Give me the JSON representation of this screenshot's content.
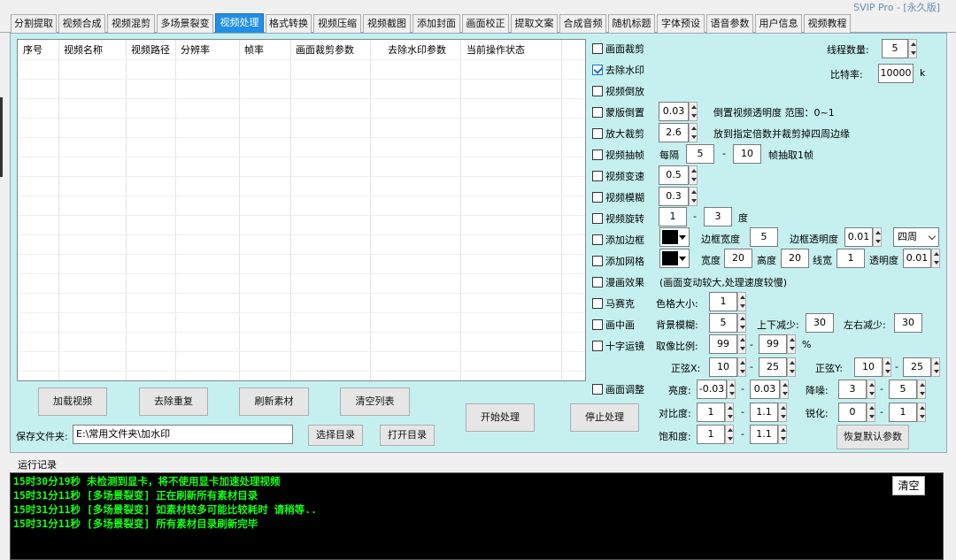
{
  "app": {
    "title": "SVIP Pro - [永久版]"
  },
  "tabs": [
    "分割提取",
    "视频合成",
    "视频混剪",
    "多场景裂变",
    "视频处理",
    "格式转换",
    "视频压缩",
    "视频截图",
    "添加封面",
    "画面校正",
    "提取文案",
    "合成音频",
    "随机标题",
    "字体预设",
    "语音参数",
    "用户信息",
    "视频教程"
  ],
  "list": {
    "columns": [
      "序号",
      "视频名称",
      "视频路径",
      "分辨率",
      "帧率",
      "画面裁剪参数",
      "去除水印参数",
      "当前操作状态"
    ]
  },
  "buttons": {
    "load": "加载视频",
    "dedupe": "去除重复",
    "refresh": "刷新素材",
    "clear_list": "清空列表",
    "start": "开始处理",
    "stop": "停止处理",
    "choose_dir": "选择目录",
    "open_dir": "打开目录",
    "reset": "恢复默认参数"
  },
  "save": {
    "label": "保存文件夹:",
    "path": "E:\\常用文件夹\\加水印"
  },
  "settings": {
    "threads_label": "线程数量:",
    "threads": "5",
    "bitrate_label": "比特率:",
    "bitrate": "10000",
    "bitrate_unit": "k"
  },
  "options": {
    "crop": "画面裁剪",
    "remove_watermark": "去除水印",
    "reverse": "视频倒放",
    "mask_reverse": "蒙版倒置",
    "mask_value": "0.03",
    "mask_desc": "倒置视频透明度 范围：0~1",
    "zoom_crop": "放大裁剪",
    "zoom_value": "2.6",
    "zoom_desc": "放到指定倍数并裁剪掉四周边缘",
    "frame_drop": "视频抽帧",
    "every": "每隔",
    "drop_from": "5",
    "drop_to": "10",
    "drop_desc": "帧抽取1帧",
    "speed": "视频变速",
    "speed_value": "0.5",
    "blur": "视频模糊",
    "blur_value": "0.3",
    "rotate": "视频旋转",
    "rotate_from": "1",
    "rotate_to": "3",
    "rotate_unit": "度",
    "border": "添加边框",
    "border_width_label": "边框宽度",
    "border_width": "5",
    "border_alpha_label": "边框透明度",
    "border_alpha": "0.01",
    "border_side": "四周",
    "grid": "添加网格",
    "grid_w_label": "宽度",
    "grid_w": "20",
    "grid_h_label": "高度",
    "grid_h": "20",
    "grid_line_label": "线宽",
    "grid_line": "1",
    "grid_alpha_label": "透明度",
    "grid_alpha": "0.01",
    "comic": "漫画效果",
    "comic_desc": "(画面变动较大,处理速度较慢)",
    "mosaic": "马赛克",
    "mosaic_size_label": "色格大小:",
    "mosaic_size": "1",
    "pip": "画中画",
    "pip_bg_label": "背景模糊:",
    "pip_bg": "5",
    "pip_tb_label": "上下减少:",
    "pip_tb": "30",
    "pip_lr_label": "左右减少:",
    "pip_lr": "30",
    "cross": "十字运镜",
    "cross_ratio_label": "取像比例:",
    "cross_from": "99",
    "cross_to": "99",
    "cross_unit": "%",
    "cross_x_label": "正弦X:",
    "cross_x_from": "10",
    "cross_x_to": "25",
    "cross_y_label": "正弦Y:",
    "cross_y_from": "10",
    "cross_y_to": "25",
    "adjust": "画面调整",
    "brightness_label": "亮度:",
    "brightness_from": "-0.03",
    "brightness_to": "0.03",
    "denoise_label": "降噪:",
    "denoise_from": "3",
    "denoise_to": "5",
    "contrast_label": "对比度:",
    "contrast_from": "1",
    "contrast_to": "1.1",
    "sharpen_label": "锐化:",
    "sharpen_from": "0",
    "sharpen_to": "1",
    "saturation_label": "饱和度:",
    "saturation_from": "1",
    "saturation_to": "1.1",
    "dash": "-"
  },
  "log": {
    "title": "运行记录",
    "clear": "清空",
    "lines": [
      "15时30分19秒 未检测到显卡，将不使用显卡加速处理视频",
      "15时31分11秒 [多场景裂变] 正在刷新所有素材目录",
      "15时31分11秒 [多场景裂变] 如素材较多可能比较耗时 请稍等..",
      "15时31分11秒 [多场景裂变] 所有素材目录刷新完毕"
    ]
  }
}
